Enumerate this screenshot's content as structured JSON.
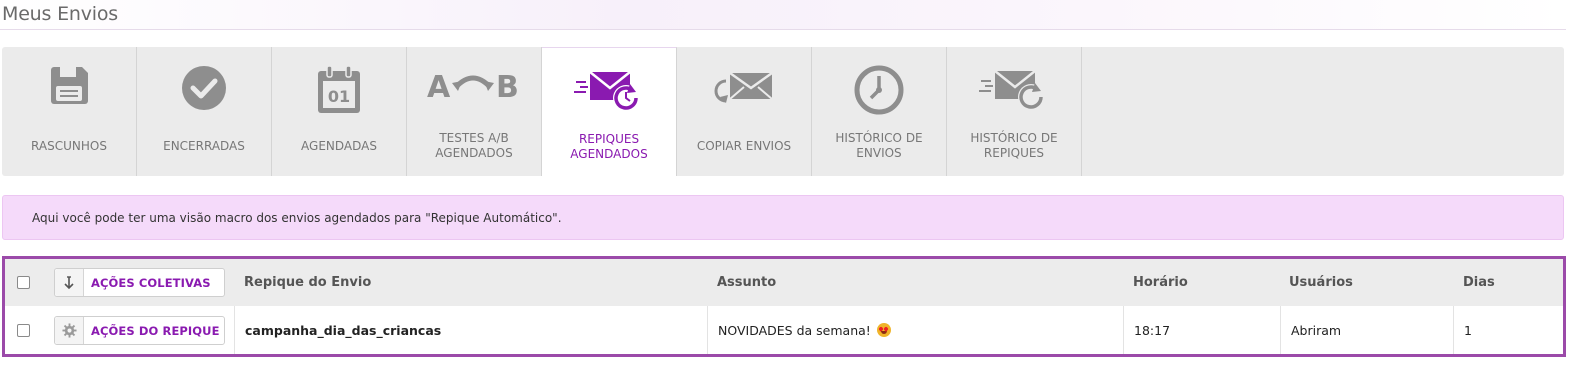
{
  "page": {
    "title": "Meus Envios"
  },
  "tabs": [
    {
      "label": "RASCUNHOS",
      "icon": "save-icon",
      "active": false
    },
    {
      "label": "ENCERRADAS",
      "icon": "check-circle-icon",
      "active": false
    },
    {
      "label": "AGENDADAS",
      "icon": "calendar-icon",
      "active": false,
      "calendar_day": "01"
    },
    {
      "label": "TESTES A/B\nAGENDADOS",
      "icon": "ab-test-icon",
      "active": false
    },
    {
      "label": "REPIQUES\nAGENDADOS",
      "icon": "scheduled-resend-icon",
      "active": true
    },
    {
      "label": "COPIAR ENVIOS",
      "icon": "copy-envelope-icon",
      "active": false
    },
    {
      "label": "HISTÓRICO DE\nENVIOS",
      "icon": "clock-icon",
      "active": false
    },
    {
      "label": "HISTÓRICO DE\nREPIQUES",
      "icon": "resend-history-icon",
      "active": false
    }
  ],
  "info": {
    "text": "Aqui você pode ter uma visão macro dos envios agendados para \"Repique Automático\"."
  },
  "table": {
    "bulk_actions_label": "AÇÕES COLETIVAS",
    "columns": [
      "Repique do Envio",
      "Assunto",
      "Horário",
      "Usuários",
      "Dias"
    ],
    "rows": [
      {
        "actions_label": "AÇÕES DO REPIQUE",
        "envio": "campanha_dia_das_criancas",
        "assunto": "NOVIDADES da semana!",
        "assunto_emoji": "heart-eyes-emoji",
        "horario": "18:17",
        "usuarios": "Abriram",
        "dias": "1"
      }
    ]
  },
  "colors": {
    "accent": "#8a1ab0",
    "icon_gray": "#8e8e8e",
    "info_bg": "#f5dafa",
    "table_border": "#9b4aa9"
  }
}
